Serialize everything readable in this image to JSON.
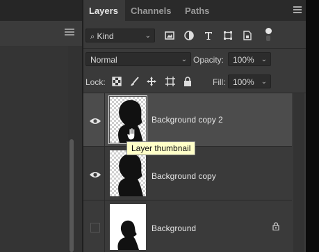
{
  "tabs": {
    "layers": "Layers",
    "channels": "Channels",
    "paths": "Paths"
  },
  "filter": {
    "kind_label": "Kind",
    "icons": [
      "pixel-layer-filter-icon",
      "adjustment-filter-icon",
      "type-filter-icon",
      "shape-filter-icon",
      "smart-object-filter-icon"
    ]
  },
  "blend": {
    "mode": "Normal",
    "opacity_label": "Opacity:",
    "opacity": "100%"
  },
  "lock": {
    "label": "Lock:",
    "fill_label": "Fill:",
    "fill": "100%"
  },
  "layers": [
    {
      "name": "Background copy 2",
      "visible": true,
      "selected": true,
      "transparent": true,
      "locked": false
    },
    {
      "name": "Background copy",
      "visible": true,
      "selected": false,
      "transparent": true,
      "locked": false
    },
    {
      "name": "Background",
      "visible": false,
      "selected": false,
      "transparent": false,
      "locked": true
    }
  ],
  "tooltip": "Layer thumbnail",
  "colors": {
    "panel_bg": "#3a3a3a",
    "selected_row": "#4c4c4c",
    "tooltip_bg": "#ffffc8"
  }
}
